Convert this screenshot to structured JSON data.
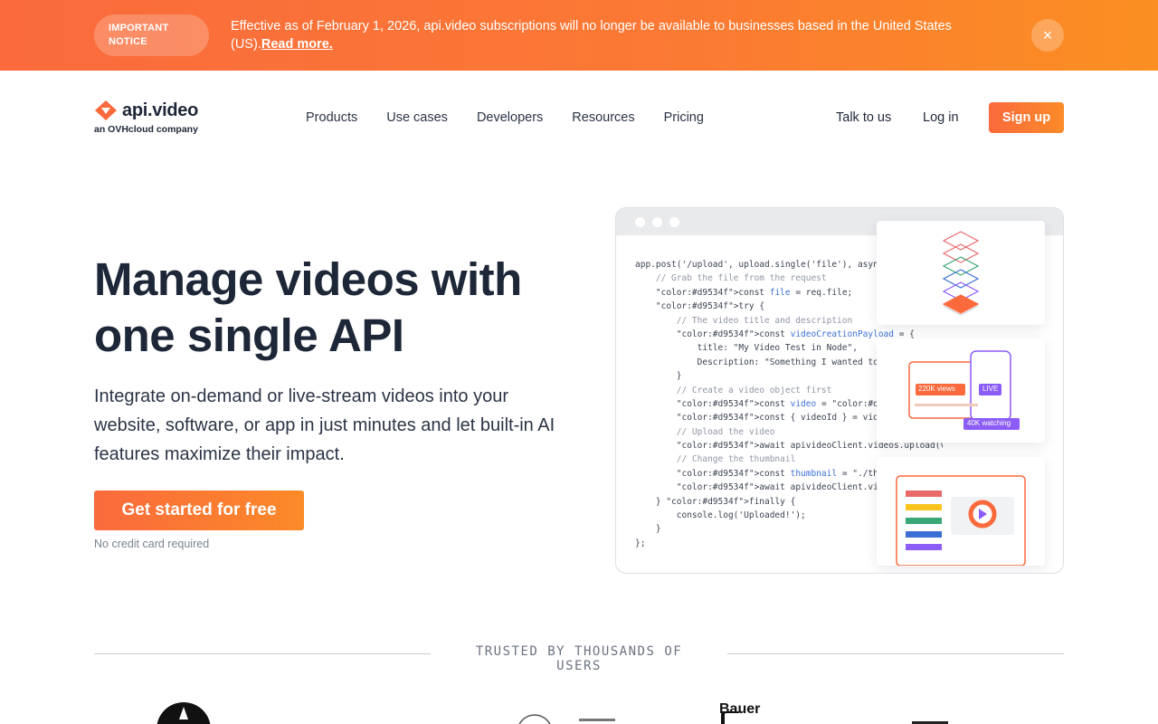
{
  "notice": {
    "badge_line1": "IMPORTANT",
    "badge_line2": "NOTICE",
    "message": "Effective as of February 1, 2026, api.video subscriptions will no longer be available to businesses based in the United States (US).",
    "link": "Read more.",
    "close_symbol": "×"
  },
  "header": {
    "logo_name": "api.video",
    "logo_sub": "an OVHcloud company",
    "nav": [
      "Products",
      "Use cases",
      "Developers",
      "Resources",
      "Pricing"
    ],
    "talk": "Talk to us",
    "login": "Log in",
    "signup": "Sign up"
  },
  "hero": {
    "title_line1": "Manage videos with",
    "title_line2": "one single API",
    "description": "Integrate on-demand or live-stream videos into your website, software, or app in just minutes and let built-in AI features maximize their impact.",
    "cta": "Get started for free",
    "cta_note": "No credit card required"
  },
  "code": {
    "lines": [
      "app.post('/upload', upload.single('file'), asyn",
      "    // Grab the file from the request",
      "    const file = req.file;",
      "    try {",
      "        // The video title and description",
      "        const videoCreationPayload = {",
      "            title: \"My Video Test in Node\",",
      "            Description: \"Something I wanted to",
      "        }",
      "        // Create a video object first",
      "        const video = await apivideoClient.vide",
      "        const { videoId } = video;",
      "        // Upload the video",
      "        await apivideoClient.videos.upload(videoId, file);",
      "        // Change the thumbnail",
      "        const thumbnail = \"./thumbnail.jpg\";",
      "        await apivideoClient.videos.uploadThum",
      "    } finally {",
      "        console.log('Uploaded!');",
      "    }",
      "};"
    ]
  },
  "cards": {
    "views_badge": "220K views",
    "live_badge": "LIVE",
    "watching_badge": "40K watching"
  },
  "trusted": {
    "label": "TRUSTED BY THOUSANDS OF USERS",
    "partial_logo": "Bauer"
  },
  "colors": {
    "brand_orange": "#fa6a3d",
    "brand_orange_end": "#fb8a28",
    "text_dark": "#1e2738",
    "purple": "#8b5cf6"
  }
}
